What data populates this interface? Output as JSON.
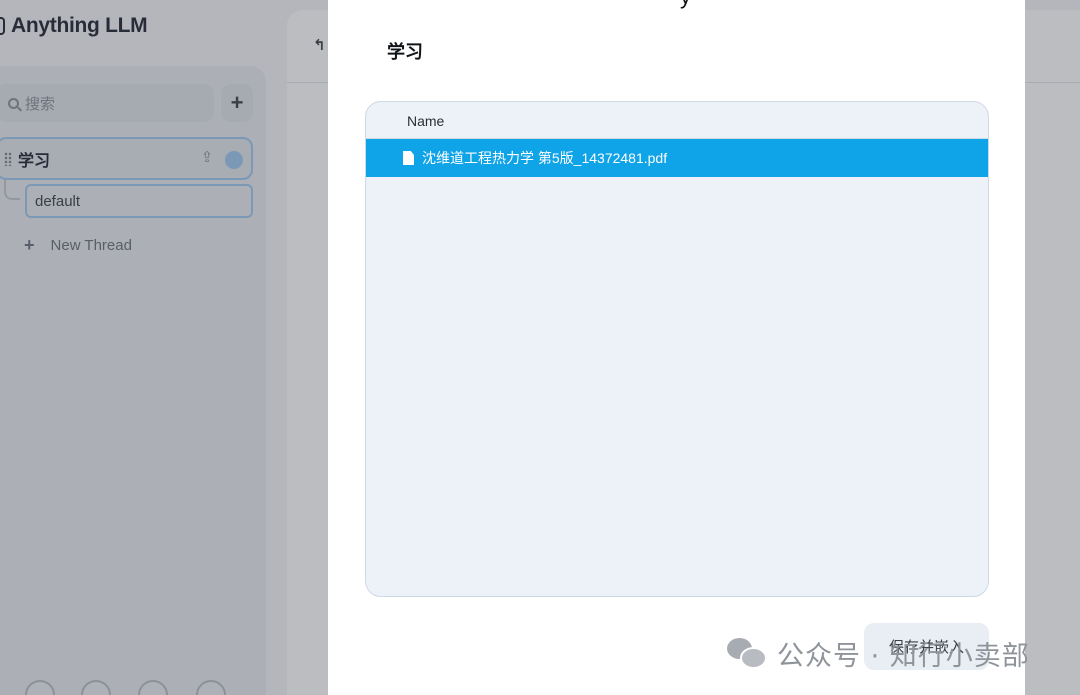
{
  "app": {
    "brand": "Anything LLM",
    "search_placeholder": "搜索",
    "new_workspace_glyph": "+",
    "upload_glyph": "⇪",
    "workspace_name": "学习",
    "thread_name": "default",
    "new_thread_label": "New Thread",
    "new_thread_glyph": "+"
  },
  "modal": {
    "title_fragment": "y",
    "workspace_title": "学习",
    "table": {
      "column_header": "Name",
      "files": [
        {
          "name": "沈维道工程热力学 第5版_14372481.pdf",
          "selected": true
        }
      ]
    },
    "save_button": "保存并嵌入"
  },
  "watermark": {
    "text": "公众号 · 知行小卖部",
    "icon": "wechat-icon"
  },
  "colors": {
    "selection": "#0fa3e8",
    "file_panel_bg": "#edf2f9",
    "accent_outline": "#9ec9ee"
  }
}
